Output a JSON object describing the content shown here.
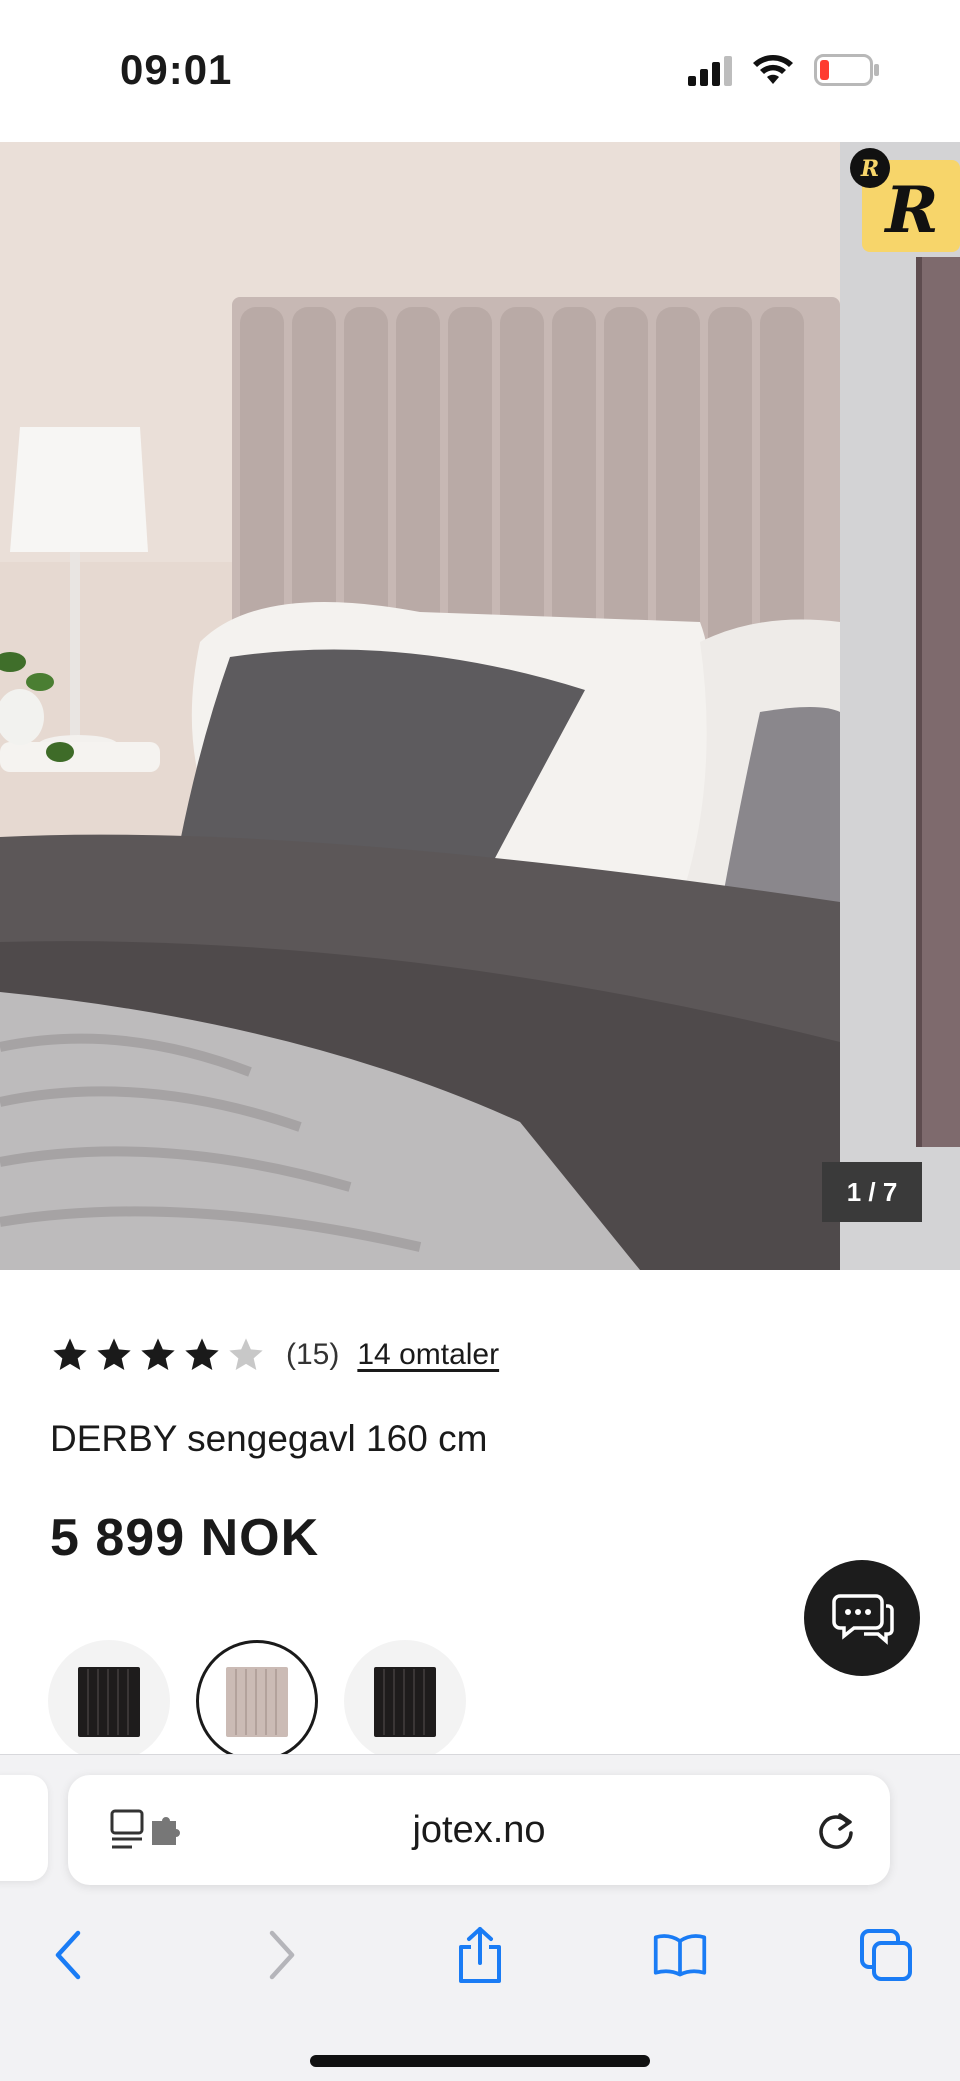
{
  "status_bar": {
    "time": "09:01",
    "icons": [
      "cellular-signal-icon",
      "wifi-icon",
      "battery-low-icon"
    ]
  },
  "gallery": {
    "counter": "1 / 7",
    "badge_icon": "r-logo-icon"
  },
  "product": {
    "rating": 4,
    "rating_max": 5,
    "rating_count": "(15)",
    "reviews_link": "14 omtaler",
    "title": "DERBY sengegavl 160 cm",
    "price": "5 899 NOK",
    "swatches": [
      {
        "color": "#1e1c1c",
        "selected": false
      },
      {
        "color": "#cbbbb5",
        "selected": true
      },
      {
        "color": "#1e1c1c",
        "selected": false
      }
    ]
  },
  "chat": {
    "icon": "chat-bubbles-icon"
  },
  "browser": {
    "url": "jotex.no",
    "toolbar": [
      "back-icon",
      "forward-icon",
      "share-icon",
      "bookmarks-icon",
      "tabs-icon"
    ]
  },
  "colors": {
    "accent": "#1a7cf5",
    "star_filled": "#1a1a1a",
    "star_empty": "#c8c8c8",
    "badge_yellow": "#f7d56a"
  }
}
